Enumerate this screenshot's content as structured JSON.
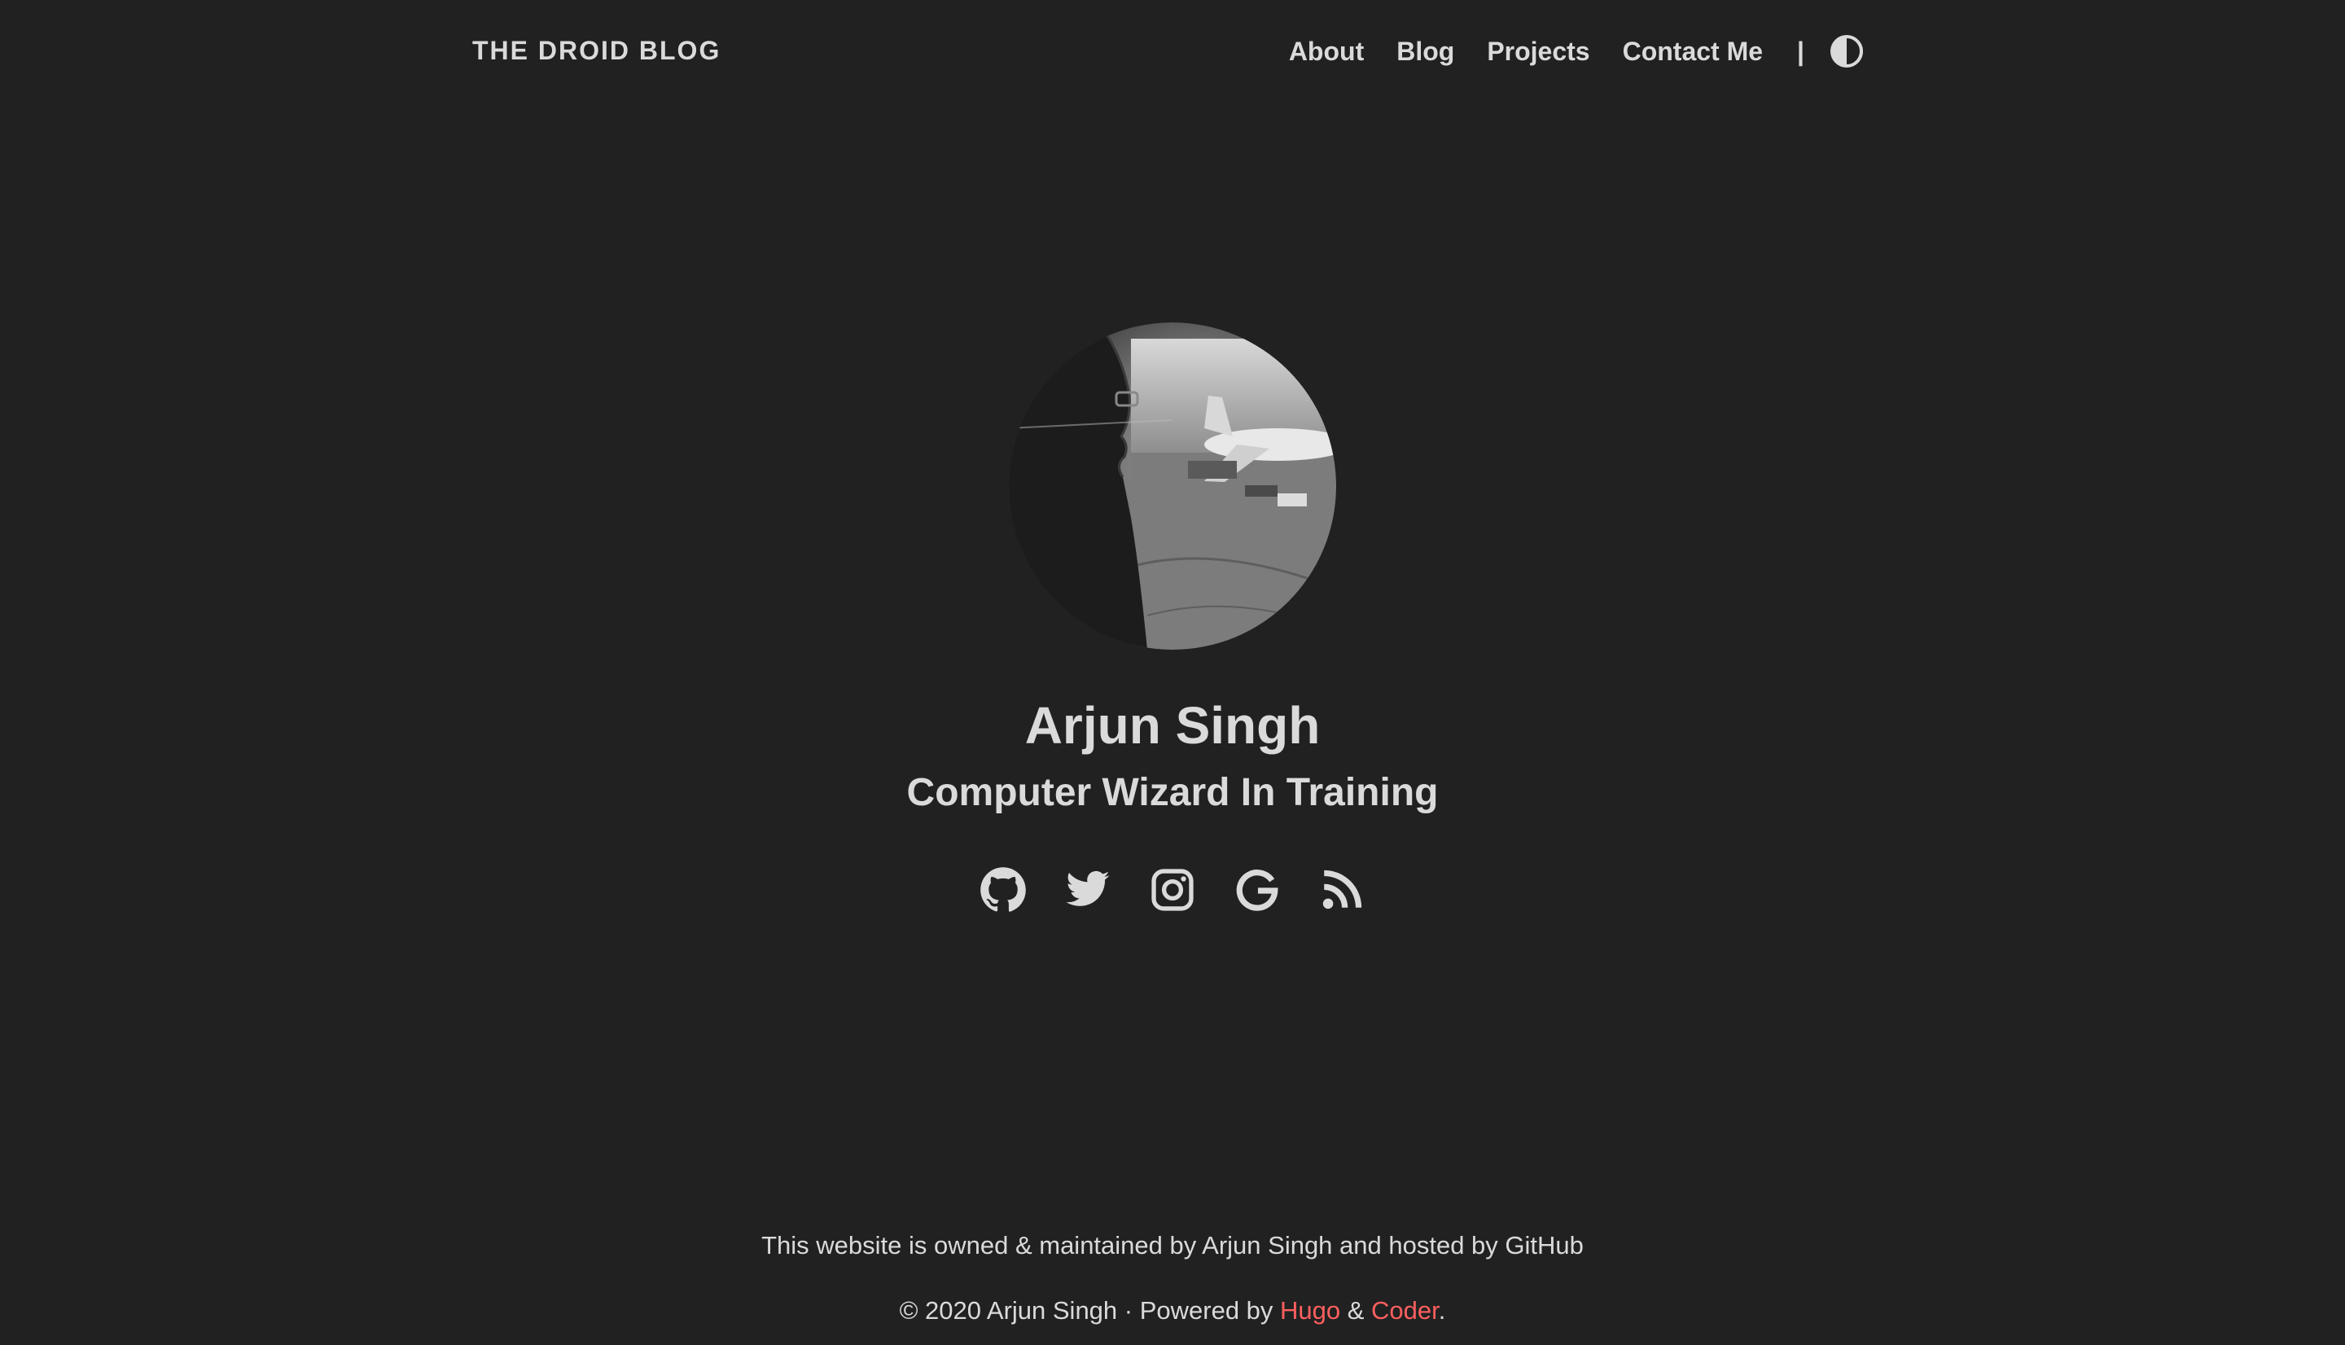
{
  "nav": {
    "brand": "THE DROID BLOG",
    "items": [
      {
        "label": "About"
      },
      {
        "label": "Blog"
      },
      {
        "label": "Projects"
      },
      {
        "label": "Contact Me"
      }
    ],
    "separator": "|",
    "theme_toggle_icon": "contrast-icon"
  },
  "profile": {
    "name": "Arjun Singh",
    "tagline": "Computer Wizard In Training",
    "avatar": "avatar",
    "socials": [
      {
        "icon": "github-icon"
      },
      {
        "icon": "twitter-icon"
      },
      {
        "icon": "instagram-icon"
      },
      {
        "icon": "google-icon"
      },
      {
        "icon": "rss-icon"
      }
    ]
  },
  "footer": {
    "notice": "This website is owned & maintained by Arjun Singh and hosted by GitHub",
    "copyright_prefix": "© 2020 Arjun Singh · Powered by ",
    "hugo_link": "Hugo",
    "amp": " & ",
    "coder_link": "Coder",
    "period": "."
  },
  "colors": {
    "background": "#212121",
    "text": "#dadada",
    "link_accent": "#ff5f5f"
  }
}
